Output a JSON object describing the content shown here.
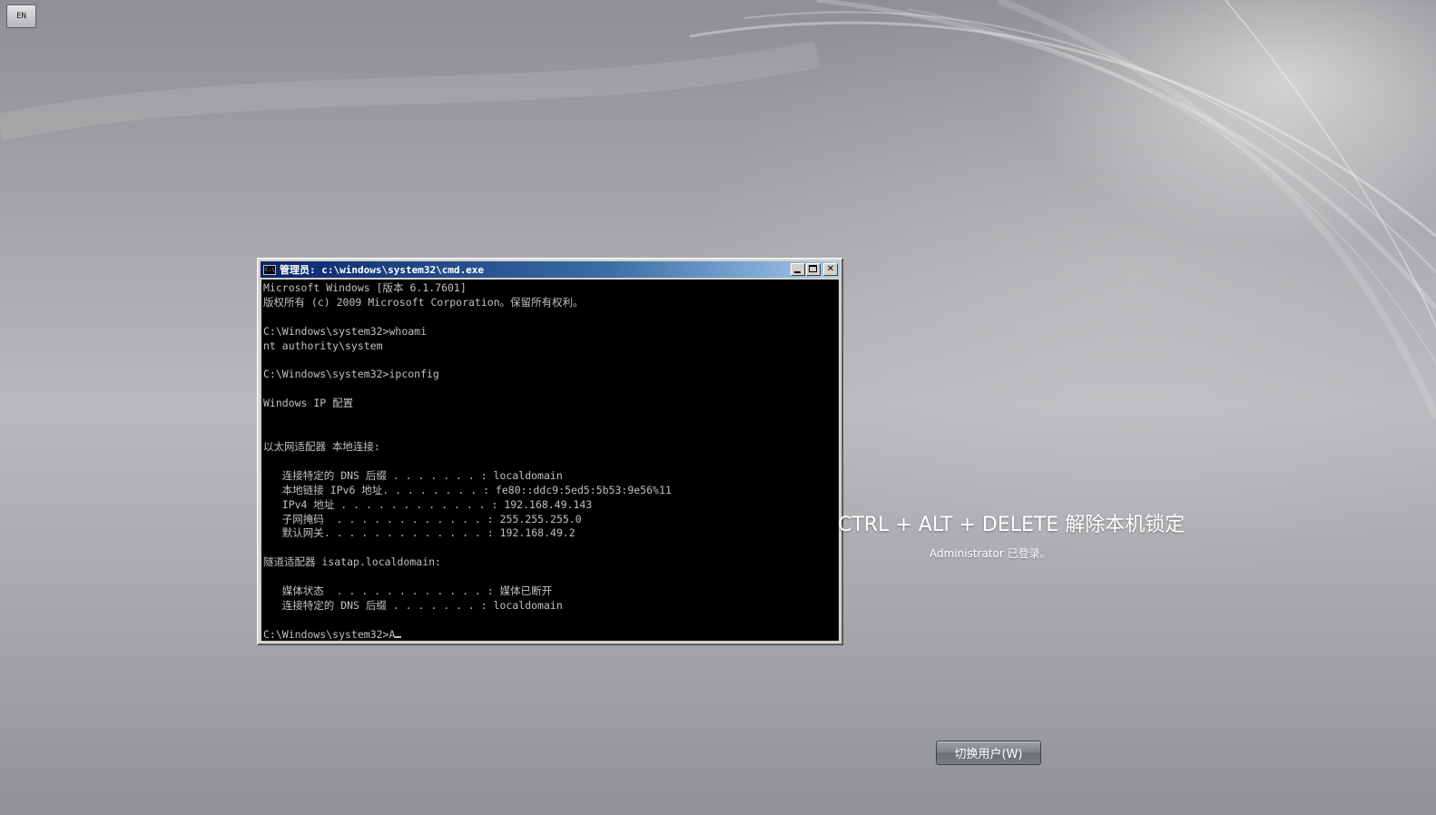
{
  "language_indicator": {
    "label": "EN"
  },
  "cmd_window": {
    "title": "管理员: c:\\windows\\system32\\cmd.exe",
    "icon_label": "C:\\",
    "controls": [
      "minimize-icon",
      "maximize-icon",
      "close-icon"
    ],
    "lines": [
      "Microsoft Windows [版本 6.1.7601]",
      "版权所有 (c) 2009 Microsoft Corporation。保留所有权利。",
      "",
      "C:\\Windows\\system32>whoami",
      "nt authority\\system",
      "",
      "C:\\Windows\\system32>ipconfig",
      "",
      "Windows IP 配置",
      "",
      "",
      "以太网适配器 本地连接:",
      "",
      "   连接特定的 DNS 后缀 . . . . . . . : localdomain",
      "   本地链接 IPv6 地址. . . . . . . . : fe80::ddc9:5ed5:5b53:9e56%11",
      "   IPv4 地址 . . . . . . . . . . . . : 192.168.49.143",
      "   子网掩码  . . . . . . . . . . . . : 255.255.255.0",
      "   默认网关. . . . . . . . . . . . . : 192.168.49.2",
      "",
      "隧道适配器 isatap.localdomain:",
      "",
      "   媒体状态  . . . . . . . . . . . . : 媒体已断开",
      "   连接特定的 DNS 后缀 . . . . . . . : localdomain",
      ""
    ],
    "prompt": "C:\\Windows\\system32>A"
  },
  "lock_screen": {
    "title": "CTRL + ALT + DELETE 解除本机锁定",
    "subtitle": "Administrator 已登录。",
    "switch_user_label": "切换用户(W)"
  },
  "colors": {
    "console_bg": "#000000",
    "console_fg": "#c0c0c0",
    "titlebar_start": "#0a246a",
    "titlebar_end": "#a6caf0"
  }
}
